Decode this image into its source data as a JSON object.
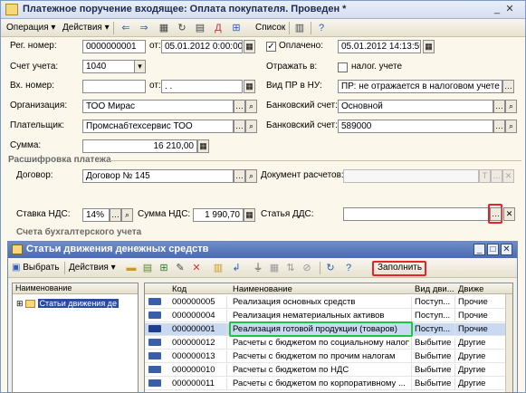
{
  "window": {
    "title": "Платежное поручение входящее: Оплата покупателя. Проведен *"
  },
  "toolbar": {
    "operation": "Операция",
    "actions": "Действия",
    "list": "Список"
  },
  "form": {
    "reg_label": "Рег. номер:",
    "reg_value": "0000000001",
    "from_label": "от:",
    "date_value": "05.01.2012  0:00:00",
    "paid_label": "Оплачено:",
    "paid_value": "05.01.2012 14:13:59",
    "account_label": "Счет учета:",
    "account_value": "1040",
    "show_label": "Отражать в:",
    "tax_label": "налог. учете",
    "in_label": "Вх. номер:",
    "in_value": "",
    "in_from": "от:",
    "in_date": " .  .",
    "vid_label": "Вид ПР в НУ:",
    "vid_value": "ПР: не отражается в налоговом учете",
    "org_label": "Организация:",
    "org_value": "ТОО Мирас",
    "bank_label": "Банковский счет:",
    "bank_value": "Основной",
    "payer_label": "Плательщик:",
    "payer_value": "Промснабтехсервис ТОО",
    "bank2_label": "Банковский счет:",
    "bank2_value": "589000",
    "sum_label": "Сумма:",
    "sum_value": "16 210,00",
    "section1": "Расшифровка платежа",
    "contract_label": "Договор:",
    "contract_value": "Договор № 145",
    "doc_label": "Документ расчетов:",
    "vat_label": "Ставка НДС:",
    "vat_value": "14%",
    "vatsum_label": "Сумма НДС:",
    "vatsum_value": "1 990,70",
    "dds_label": "Статья ДДС:",
    "section2": "Счета бухгалтерского учета"
  },
  "subwindow": {
    "title": "Статьи движения денежных средств",
    "select": "Выбрать",
    "actions": "Действия",
    "fill": "Заполнить",
    "tree_header": "Наименование",
    "tree_item": "Статьи движения де"
  },
  "grid": {
    "headers": [
      "Код",
      "Наименование",
      "Вид дви...",
      "Движе"
    ],
    "rows": [
      [
        "000000005",
        "Реализация основных средств",
        "Поступ...",
        "Прочие"
      ],
      [
        "000000004",
        "Реализация нематериальных активов",
        "Поступ...",
        "Прочие"
      ],
      [
        "000000001",
        "Реализация готовой продукции (товаров)",
        "Поступ...",
        "Прочие"
      ],
      [
        "000000012",
        "Расчеты с бюджетом по социальному налогу",
        "Выбытие",
        "Другие"
      ],
      [
        "000000013",
        "Расчеты с бюджетом по прочим налогам",
        "Выбытие",
        "Другие"
      ],
      [
        "000000010",
        "Расчеты с бюджетом по НДС",
        "Выбытие",
        "Другие"
      ],
      [
        "000000011",
        "Расчеты с бюджетом по корпоративному ...",
        "Выбытие",
        "Другие"
      ]
    ]
  },
  "colors": {
    "highlight_red": "#e0262c",
    "highlight_green": "#21c43d",
    "selected_row": "#c9d9f2"
  }
}
